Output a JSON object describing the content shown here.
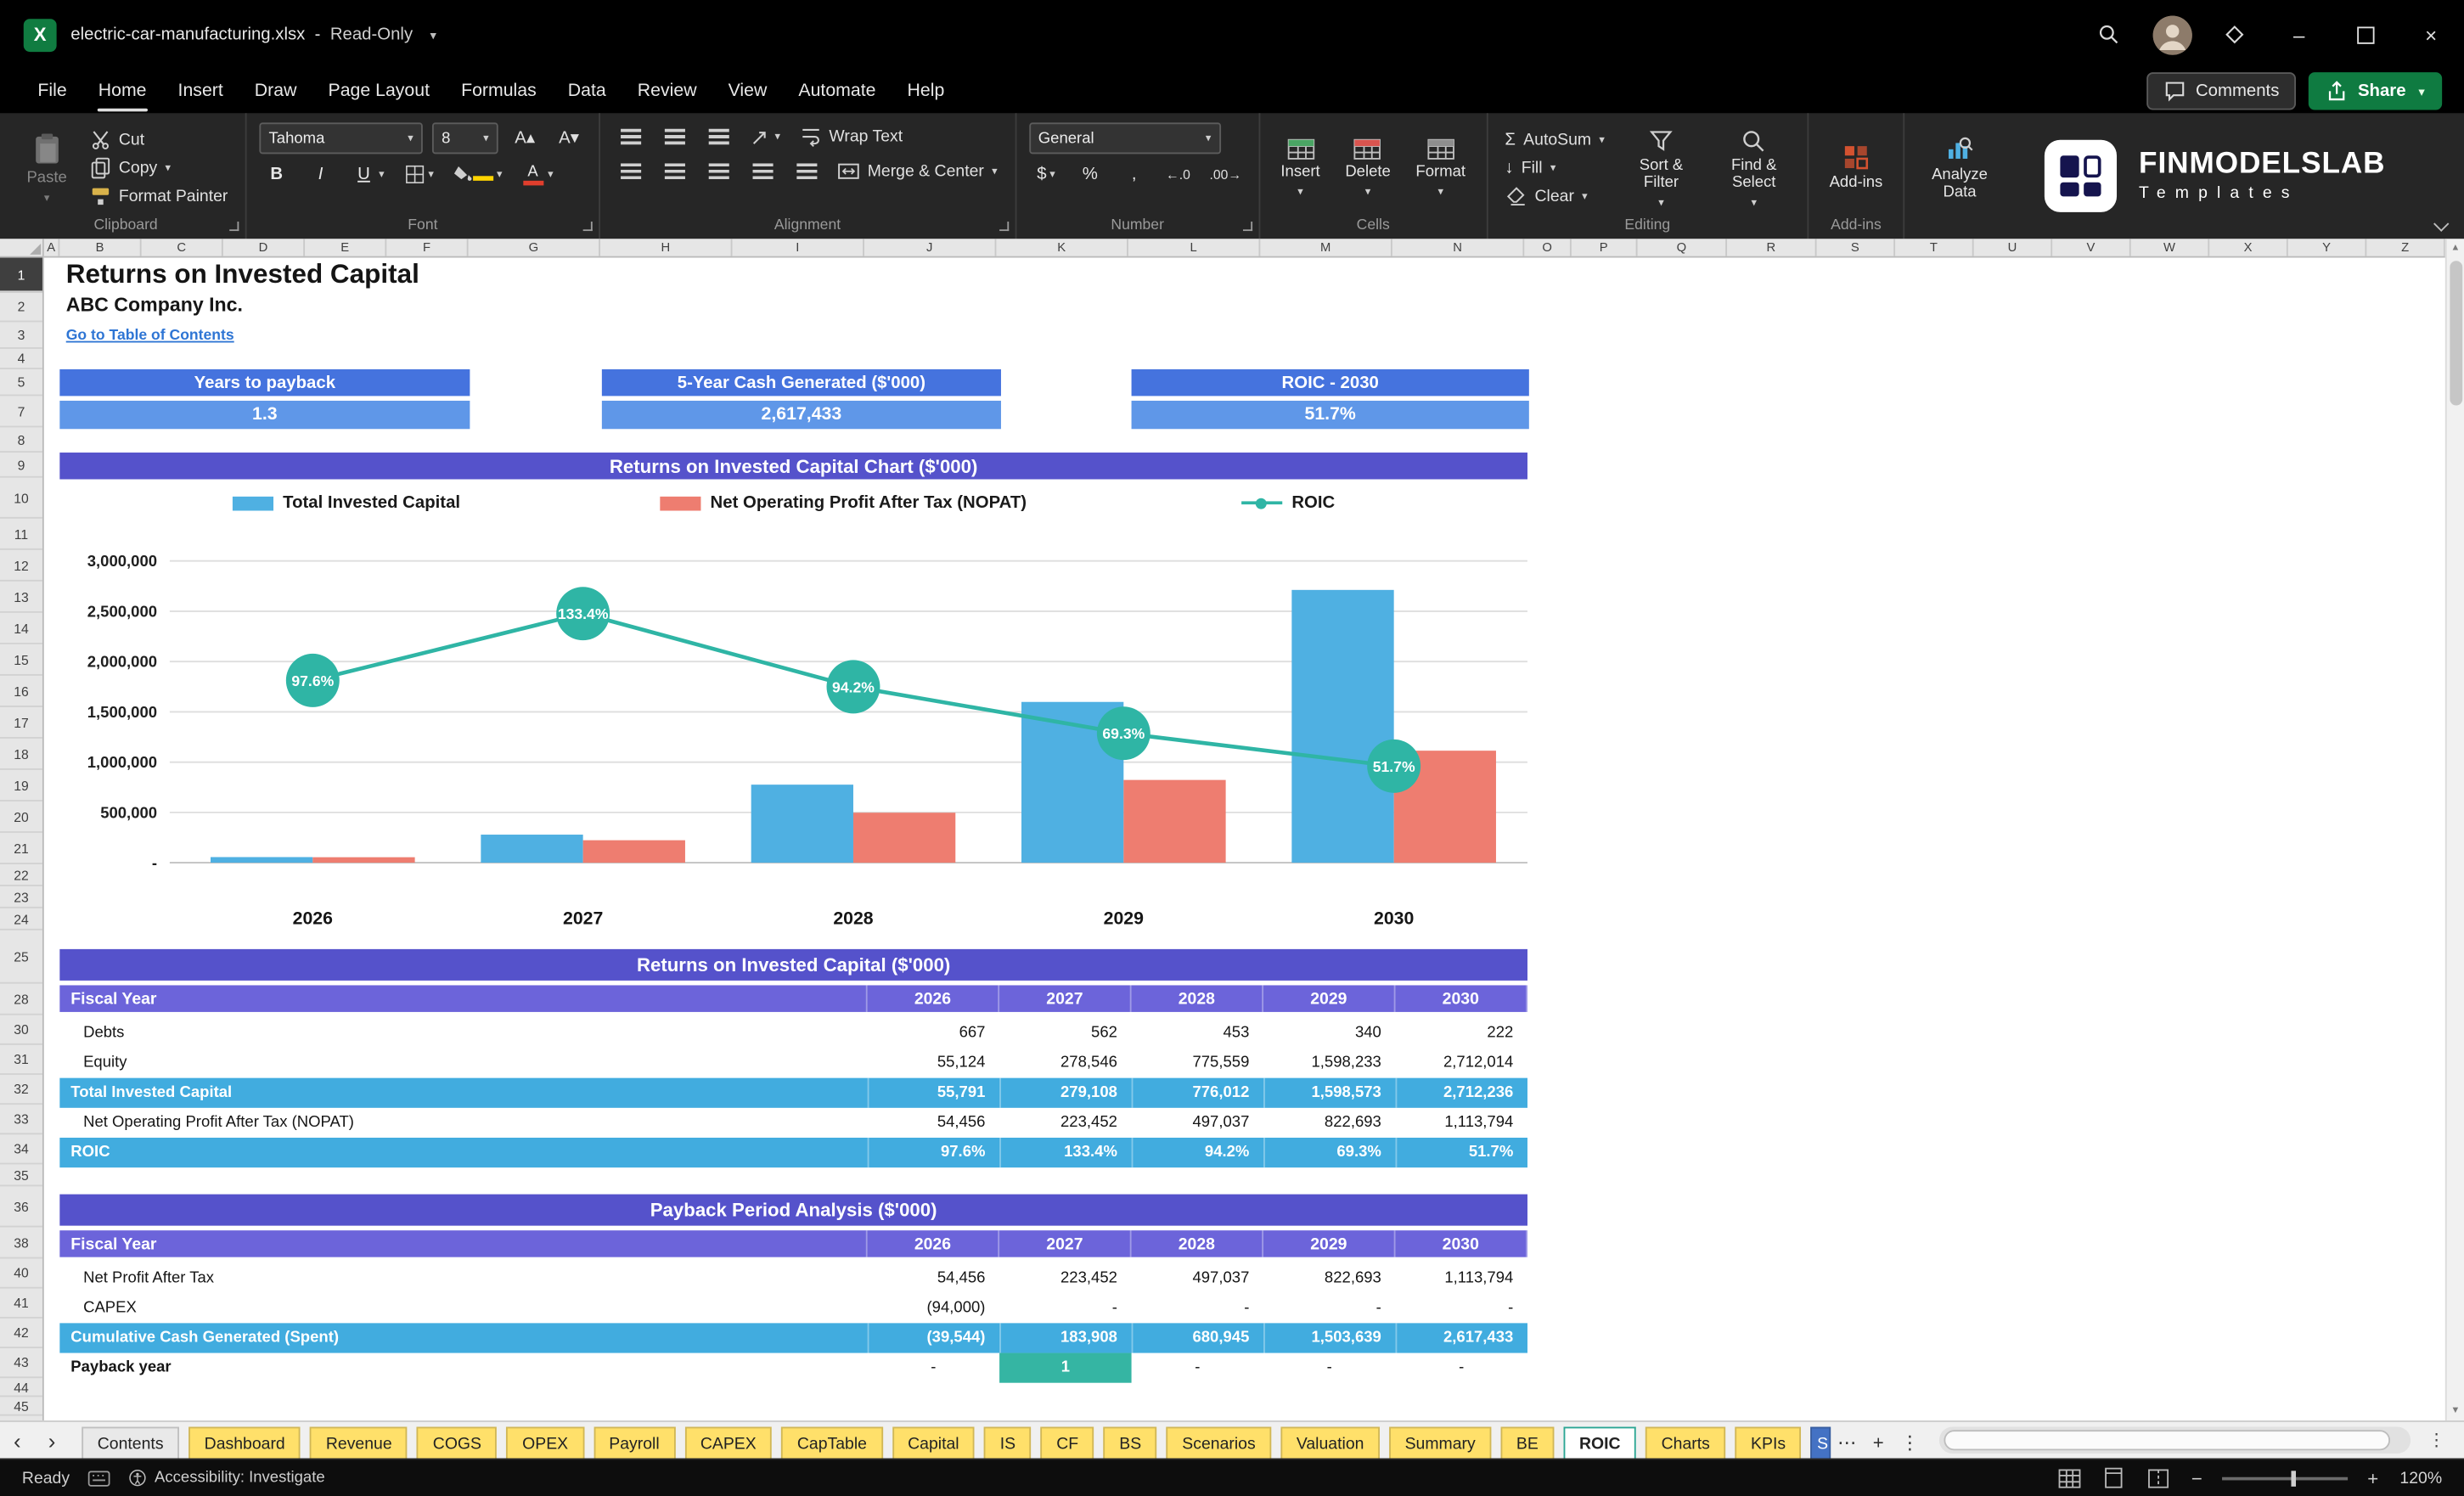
{
  "titlebar": {
    "filename": "electric-car-manufacturing.xlsx",
    "separator": "-",
    "mode": "Read-Only"
  },
  "menubar": {
    "items": [
      "File",
      "Home",
      "Insert",
      "Draw",
      "Page Layout",
      "Formulas",
      "Data",
      "Review",
      "View",
      "Automate",
      "Help"
    ],
    "active_index": 1,
    "comments": "Comments",
    "share": "Share"
  },
  "ribbon": {
    "clipboard": {
      "paste": "Paste",
      "cut": "Cut",
      "copy": "Copy",
      "format_painter": "Format Painter",
      "group": "Clipboard"
    },
    "font": {
      "family": "Tahoma",
      "size": "8",
      "group": "Font"
    },
    "alignment": {
      "wrap_text": "Wrap Text",
      "merge_center": "Merge & Center",
      "group": "Alignment"
    },
    "number": {
      "format": "General",
      "group": "Number"
    },
    "cells": {
      "insert": "Insert",
      "delete": "Delete",
      "format": "Format",
      "group": "Cells"
    },
    "editing": {
      "autosum": "AutoSum",
      "fill": "Fill",
      "clear": "Clear",
      "sort_filter": "Sort & Filter",
      "find_select": "Find & Select",
      "group": "Editing"
    },
    "addins": {
      "label": "Add-ins",
      "group": "Add-ins"
    },
    "analyze": {
      "label": "Analyze Data"
    },
    "brand": {
      "name": "FINMODELSLAB",
      "sub": "Templates"
    }
  },
  "glyphs": {
    "dropdown": "▾",
    "minimize": "–",
    "close": "×",
    "more_tabs": "⋯",
    "add_sheet": "+",
    "sheet_menu": "⋮",
    "nav_left": "‹",
    "nav_right": "›",
    "sigma": "Σ",
    "fill_arrow": "↓",
    "dollar": "$",
    "percent": "%",
    "comma": ",",
    "inc_decimal": "←.0",
    "dec_decimal": ".00→",
    "bold": "B",
    "italic": "I",
    "underline": "U",
    "grow_font": "A▴",
    "shrink_font": "A▾",
    "zoom_out": "−",
    "zoom_in": "+",
    "scroll_up": "▲",
    "scroll_down": "▼"
  },
  "sheet": {
    "title": "Returns on Invested Capital",
    "company": "ABC Company Inc.",
    "toc_link": "Go to Table of Contents",
    "kpis": [
      {
        "label": "Years to payback",
        "value": "1.3"
      },
      {
        "label": "5-Year Cash Generated ($'000)",
        "value": "2,617,433"
      },
      {
        "label": "ROIC - 2030",
        "value": "51.7%"
      }
    ],
    "chart_header": "Returns on Invested Capital Chart ($'000)"
  },
  "chart_data": {
    "type": "bar+line",
    "title": "Returns on Invested Capital Chart ($'000)",
    "categories": [
      "2026",
      "2027",
      "2028",
      "2029",
      "2030"
    ],
    "series": [
      {
        "name": "Total Invested Capital",
        "type": "bar",
        "color": "#4FB0E2",
        "values": [
          55791,
          279108,
          776012,
          1598573,
          2712236
        ]
      },
      {
        "name": "Net Operating Profit After Tax (NOPAT)",
        "type": "bar",
        "color": "#EE7D70",
        "values": [
          54456,
          223452,
          497037,
          822693,
          1113794
        ]
      },
      {
        "name": "ROIC",
        "type": "line",
        "color": "#2FB5A5",
        "values_percent": [
          97.6,
          133.4,
          94.2,
          69.3,
          51.7
        ],
        "point_labels": [
          "97.6%",
          "133.4%",
          "94.2%",
          "69.3%",
          "51.7%"
        ]
      }
    ],
    "y_axis": {
      "min": 0,
      "max": 3000000,
      "tick_step": 500000,
      "tick_labels": [
        "3,000,000",
        "2,500,000",
        "2,000,000",
        "1,500,000",
        "1,000,000",
        "500,000",
        "-"
      ]
    },
    "gridlines": true,
    "legend_position": "top"
  },
  "tables": [
    {
      "title": "Returns on Invested Capital ($'000)",
      "columns": [
        "Fiscal Year",
        "2026",
        "2027",
        "2028",
        "2029",
        "2030"
      ],
      "rows": [
        {
          "label": "Debts",
          "indent": true,
          "style": "normal",
          "values": [
            "667",
            "562",
            "453",
            "340",
            "222"
          ]
        },
        {
          "label": "Equity",
          "indent": true,
          "style": "normal",
          "values": [
            "55,124",
            "278,546",
            "775,559",
            "1,598,233",
            "2,712,014"
          ]
        },
        {
          "label": "Total Invested Capital",
          "indent": false,
          "style": "highlight",
          "values": [
            "55,791",
            "279,108",
            "776,012",
            "1,598,573",
            "2,712,236"
          ]
        },
        {
          "label": "Net Operating Profit After Tax (NOPAT)",
          "indent": true,
          "style": "normal",
          "values": [
            "54,456",
            "223,452",
            "497,037",
            "822,693",
            "1,113,794"
          ]
        },
        {
          "label": "ROIC",
          "indent": false,
          "style": "highlight",
          "values": [
            "97.6%",
            "133.4%",
            "94.2%",
            "69.3%",
            "51.7%"
          ]
        }
      ]
    },
    {
      "title": "Payback Period Analysis ($'000)",
      "columns": [
        "Fiscal Year",
        "2026",
        "2027",
        "2028",
        "2029",
        "2030"
      ],
      "rows": [
        {
          "label": "Net Profit After Tax",
          "indent": true,
          "style": "normal",
          "values": [
            "54,456",
            "223,452",
            "497,037",
            "822,693",
            "1,113,794"
          ]
        },
        {
          "label": "CAPEX",
          "indent": true,
          "style": "normal",
          "values": [
            "(94,000)",
            "-",
            "-",
            "-",
            "-"
          ]
        },
        {
          "label": "Cumulative Cash Generated (Spent)",
          "indent": false,
          "style": "highlight",
          "values": [
            "(39,544)",
            "183,908",
            "680,945",
            "1,503,639",
            "2,617,433"
          ]
        },
        {
          "label": "Payback year",
          "indent": false,
          "style": "payback",
          "values": [
            "-",
            "1",
            "-",
            "-",
            "-"
          ],
          "highlight_col": 1
        }
      ]
    }
  ],
  "sheet_tabs": {
    "items": [
      {
        "label": "Contents",
        "color": "gray"
      },
      {
        "label": "Dashboard",
        "color": "yellow"
      },
      {
        "label": "Revenue",
        "color": "yellow"
      },
      {
        "label": "COGS",
        "color": "yellow"
      },
      {
        "label": "OPEX",
        "color": "yellow"
      },
      {
        "label": "Payroll",
        "color": "yellow"
      },
      {
        "label": "CAPEX",
        "color": "yellow"
      },
      {
        "label": "CapTable",
        "color": "yellow"
      },
      {
        "label": "Capital",
        "color": "yellow"
      },
      {
        "label": "IS",
        "color": "yellow"
      },
      {
        "label": "CF",
        "color": "yellow"
      },
      {
        "label": "BS",
        "color": "yellow"
      },
      {
        "label": "Scenarios",
        "color": "yellow"
      },
      {
        "label": "Valuation",
        "color": "yellow"
      },
      {
        "label": "Summary",
        "color": "yellow"
      },
      {
        "label": "BE",
        "color": "yellow"
      },
      {
        "label": "ROIC",
        "color": "white",
        "active": true
      },
      {
        "label": "Charts",
        "color": "yellow"
      },
      {
        "label": "KPIs",
        "color": "yellow"
      },
      {
        "label": "S",
        "color": "blue",
        "clipped": true
      }
    ]
  },
  "statusbar": {
    "ready": "Ready",
    "accessibility": "Accessibility: Investigate",
    "zoom": "120%"
  },
  "grid": {
    "columns": [
      [
        "A",
        10
      ],
      [
        "B",
        52
      ],
      [
        "C",
        52
      ],
      [
        "D",
        52
      ],
      [
        "E",
        52
      ],
      [
        "F",
        52
      ],
      [
        "G",
        84
      ],
      [
        "H",
        84
      ],
      [
        "I",
        84
      ],
      [
        "J",
        84
      ],
      [
        "K",
        84
      ],
      [
        "L",
        84
      ],
      [
        "M",
        84
      ],
      [
        "N",
        84
      ],
      [
        "O",
        30
      ],
      [
        "P",
        42
      ],
      [
        "Q",
        57
      ],
      [
        "R",
        57
      ],
      [
        "S",
        50
      ],
      [
        "T",
        50
      ],
      [
        "U",
        50
      ],
      [
        "V",
        50
      ],
      [
        "W",
        50
      ],
      [
        "X",
        50
      ],
      [
        "Y",
        50
      ],
      [
        "Z",
        50
      ]
    ],
    "rows": [
      [
        "1",
        22
      ],
      [
        "2",
        19
      ],
      [
        "3",
        17
      ],
      [
        "4",
        13
      ],
      [
        "5",
        17
      ],
      [
        "7",
        20
      ],
      [
        "8",
        16
      ],
      [
        "9",
        16
      ],
      [
        "10",
        26
      ],
      [
        "11",
        20
      ],
      [
        "12",
        20
      ],
      [
        "13",
        20
      ],
      [
        "14",
        20
      ],
      [
        "15",
        20
      ],
      [
        "16",
        20
      ],
      [
        "17",
        20
      ],
      [
        "18",
        20
      ],
      [
        "19",
        20
      ],
      [
        "20",
        20
      ],
      [
        "21",
        20
      ],
      [
        "22",
        14
      ],
      [
        "23",
        14
      ],
      [
        "24",
        14
      ],
      [
        "25",
        34
      ],
      [
        "28",
        20
      ],
      [
        "30",
        19
      ],
      [
        "31",
        19
      ],
      [
        "32",
        19
      ],
      [
        "33",
        19
      ],
      [
        "34",
        19
      ],
      [
        "35",
        14
      ],
      [
        "36",
        26
      ],
      [
        "38",
        20
      ],
      [
        "40",
        19
      ],
      [
        "41",
        19
      ],
      [
        "42",
        19
      ],
      [
        "43",
        19
      ],
      [
        "44",
        12
      ],
      [
        "45",
        12
      ]
    ]
  }
}
